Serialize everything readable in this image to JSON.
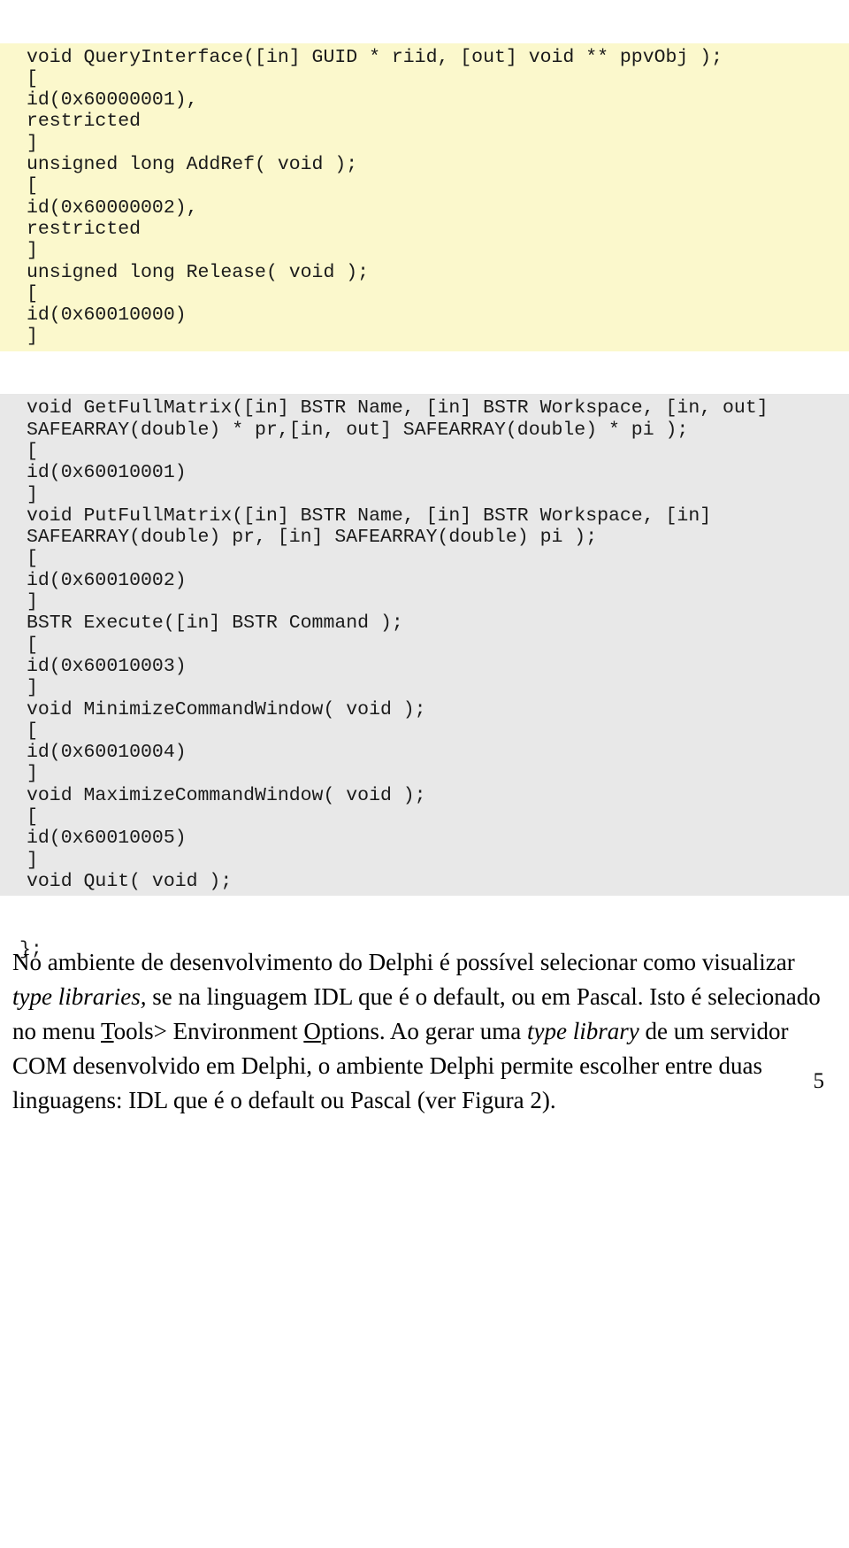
{
  "document": {
    "page_number": "5",
    "code_listing": {
      "language": "IDL",
      "blocks": [
        {
          "highlight": "yellow",
          "lines": [
            "void QueryInterface([in] GUID * riid, [out] void ** ppvObj );",
            "[",
            "id(0x60000001),",
            "restricted",
            "]",
            "unsigned long AddRef( void );",
            "[",
            "id(0x60000002),",
            "restricted",
            "]",
            "unsigned long Release( void );",
            "[",
            "id(0x60010000)",
            "]"
          ]
        },
        {
          "highlight": "gray",
          "lines": [
            "void GetFullMatrix([in] BSTR Name, [in] BSTR Workspace, [in, out] SAFEARRAY(double) * pr,[in, out] SAFEARRAY(double) * pi );",
            "[",
            "id(0x60010001)",
            "]",
            "void PutFullMatrix([in] BSTR Name, [in] BSTR Workspace, [in] SAFEARRAY(double) pr, [in] SAFEARRAY(double) pi );",
            "[",
            "id(0x60010002)",
            "]",
            "BSTR Execute([in] BSTR Command );",
            "[",
            "id(0x60010003)",
            "]",
            "void MinimizeCommandWindow( void );",
            "[",
            "id(0x60010004)",
            "]",
            "void MaximizeCommandWindow( void );",
            "[",
            "id(0x60010005)",
            "]",
            "void Quit( void );"
          ]
        }
      ],
      "tail_line": "};"
    },
    "paragraph": {
      "segments": [
        {
          "text": "No ambiente de desenvolvimento do Delphi é possível selecionar como visualizar ",
          "style": "normal"
        },
        {
          "text": "type libraries,",
          "style": "italic"
        },
        {
          "text": " se na linguagem IDL que é o default, ou em Pascal. Isto é selecionado no menu ",
          "style": "normal"
        },
        {
          "text": "T",
          "style": "underline"
        },
        {
          "text": "ools> Environment ",
          "style": "normal"
        },
        {
          "text": "O",
          "style": "underline"
        },
        {
          "text": "ptions. Ao gerar uma ",
          "style": "normal"
        },
        {
          "text": "type library",
          "style": "italic"
        },
        {
          "text": " de um servidor COM desenvolvido em Delphi, o ambiente Delphi permite escolher entre duas linguagens: IDL que é o default ou Pascal (ver Figura 2).",
          "style": "normal"
        }
      ]
    }
  },
  "colors": {
    "highlight_yellow": "#fbf8cc",
    "highlight_gray": "#e8e8e8",
    "text": "#000000",
    "page_background": "#ffffff"
  }
}
